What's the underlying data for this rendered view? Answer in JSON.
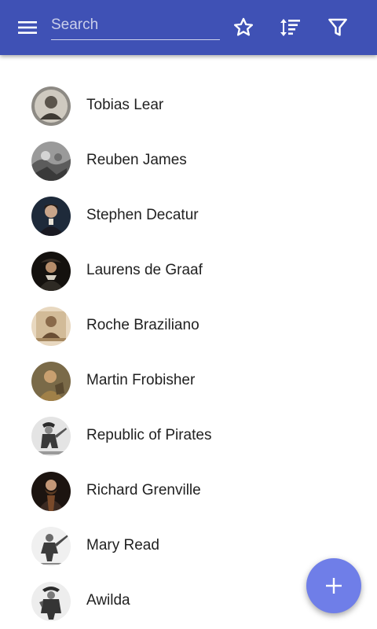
{
  "app_bar": {
    "search_placeholder": "Search",
    "accent_color": "#3f51b5",
    "icons": [
      "menu-icon",
      "star-outline-icon",
      "sort-icon",
      "filter-icon"
    ]
  },
  "list": {
    "items": [
      {
        "name": "Tobias Lear",
        "avatar_tone": "#8d8a84"
      },
      {
        "name": "Reuben James",
        "avatar_tone": "#9a9a9a"
      },
      {
        "name": "Stephen Decatur",
        "avatar_tone": "#4a3a2c"
      },
      {
        "name": "Laurens de Graaf",
        "avatar_tone": "#2e2a24"
      },
      {
        "name": "Roche Braziliano",
        "avatar_tone": "#d7c2a6"
      },
      {
        "name": "Martin Frobisher",
        "avatar_tone": "#7a6a48"
      },
      {
        "name": "Republic of Pirates",
        "avatar_tone": "#b9b9b9"
      },
      {
        "name": "Richard Grenville",
        "avatar_tone": "#3b2a22"
      },
      {
        "name": "Mary Read",
        "avatar_tone": "#c4c4c4"
      },
      {
        "name": "Awilda",
        "avatar_tone": "#bdbdbd"
      }
    ]
  },
  "fab": {
    "icon": "plus-icon",
    "color": "#6f7ee8"
  }
}
